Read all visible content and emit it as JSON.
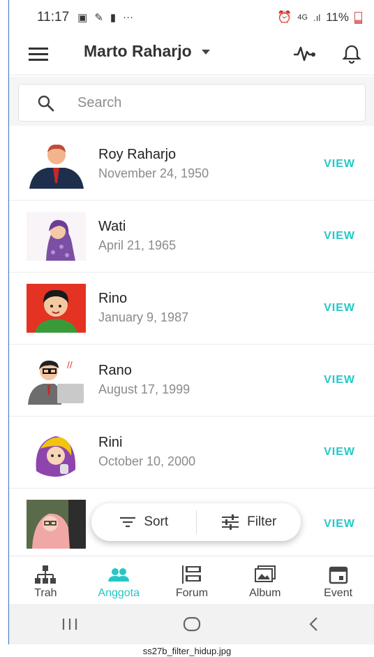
{
  "status_bar": {
    "time": "11:17",
    "ellipsis": "···",
    "network": "4G",
    "battery": "11%"
  },
  "app_bar": {
    "title": "Marto Raharjo"
  },
  "search": {
    "placeholder": "Search"
  },
  "members": [
    {
      "name": "Roy Raharjo",
      "date": "November 24, 1950",
      "action": "VIEW"
    },
    {
      "name": "Wati",
      "date": "April 21, 1965",
      "action": "VIEW"
    },
    {
      "name": "Rino",
      "date": "January 9, 1987",
      "action": "VIEW"
    },
    {
      "name": "Rano",
      "date": "August 17, 1999",
      "action": "VIEW"
    },
    {
      "name": "Rini",
      "date": "October 10, 2000",
      "action": "VIEW"
    },
    {
      "name": "",
      "date": "",
      "action": "VIEW"
    }
  ],
  "fab": {
    "sort_label": "Sort",
    "filter_label": "Filter"
  },
  "bottom_nav": [
    {
      "label": "Trah",
      "icon": "tree-icon"
    },
    {
      "label": "Anggota",
      "icon": "people-icon",
      "active": true
    },
    {
      "label": "Forum",
      "icon": "forum-icon"
    },
    {
      "label": "Album",
      "icon": "album-icon"
    },
    {
      "label": "Event",
      "icon": "calendar-icon"
    }
  ],
  "caption": "ss27b_filter_hidup.jpg",
  "colors": {
    "accent": "#26c6c6",
    "text": "#222222",
    "muted": "#8a8a8a"
  }
}
